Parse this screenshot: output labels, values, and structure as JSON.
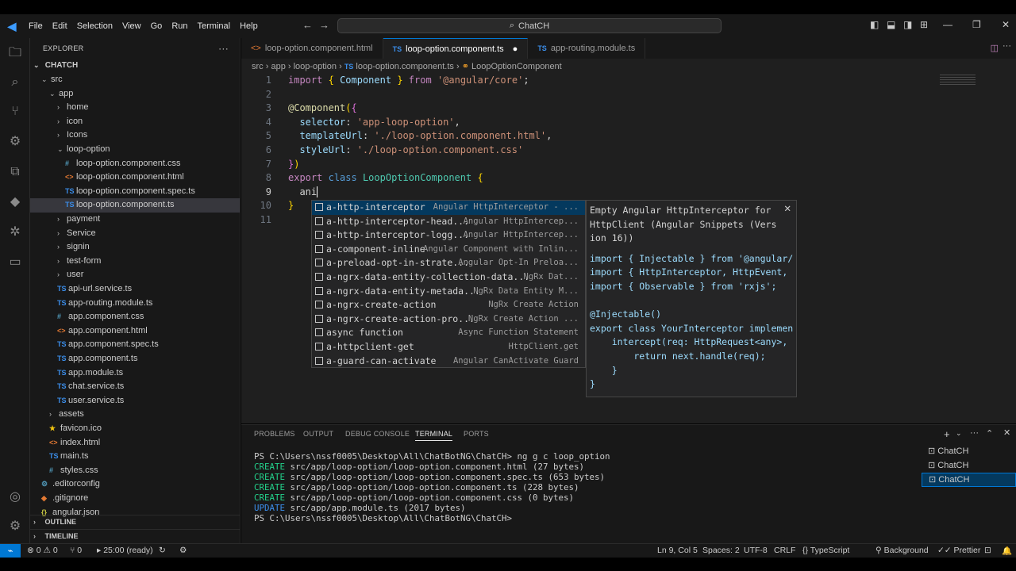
{
  "titlebar": {
    "menu": [
      "File",
      "Edit",
      "Selection",
      "View",
      "Go",
      "Run",
      "Terminal",
      "Help"
    ],
    "search_text": "ChatCH"
  },
  "sidebar": {
    "title": "EXPLORER",
    "root": "CHATCH",
    "items": [
      {
        "label": "src",
        "depth": 1,
        "kind": "folder-open"
      },
      {
        "label": "app",
        "depth": 2,
        "kind": "folder-open"
      },
      {
        "label": "home",
        "depth": 3,
        "kind": "folder"
      },
      {
        "label": "icon",
        "depth": 3,
        "kind": "folder"
      },
      {
        "label": "Icons",
        "depth": 3,
        "kind": "folder"
      },
      {
        "label": "loop-option",
        "depth": 3,
        "kind": "folder-open"
      },
      {
        "label": "loop-option.component.css",
        "depth": 4,
        "kind": "css"
      },
      {
        "label": "loop-option.component.html",
        "depth": 4,
        "kind": "html"
      },
      {
        "label": "loop-option.component.spec.ts",
        "depth": 4,
        "kind": "ts"
      },
      {
        "label": "loop-option.component.ts",
        "depth": 4,
        "kind": "ts",
        "selected": true
      },
      {
        "label": "payment",
        "depth": 3,
        "kind": "folder"
      },
      {
        "label": "Service",
        "depth": 3,
        "kind": "folder"
      },
      {
        "label": "signin",
        "depth": 3,
        "kind": "folder"
      },
      {
        "label": "test-form",
        "depth": 3,
        "kind": "folder"
      },
      {
        "label": "user",
        "depth": 3,
        "kind": "folder"
      },
      {
        "label": "api-url.service.ts",
        "depth": 3,
        "kind": "ts"
      },
      {
        "label": "app-routing.module.ts",
        "depth": 3,
        "kind": "ts"
      },
      {
        "label": "app.component.css",
        "depth": 3,
        "kind": "css"
      },
      {
        "label": "app.component.html",
        "depth": 3,
        "kind": "html"
      },
      {
        "label": "app.component.spec.ts",
        "depth": 3,
        "kind": "ts"
      },
      {
        "label": "app.component.ts",
        "depth": 3,
        "kind": "ts"
      },
      {
        "label": "app.module.ts",
        "depth": 3,
        "kind": "ts"
      },
      {
        "label": "chat.service.ts",
        "depth": 3,
        "kind": "ts"
      },
      {
        "label": "user.service.ts",
        "depth": 3,
        "kind": "ts"
      },
      {
        "label": "assets",
        "depth": 2,
        "kind": "folder"
      },
      {
        "label": "favicon.ico",
        "depth": 2,
        "kind": "star"
      },
      {
        "label": "index.html",
        "depth": 2,
        "kind": "html"
      },
      {
        "label": "main.ts",
        "depth": 2,
        "kind": "ts"
      },
      {
        "label": "styles.css",
        "depth": 2,
        "kind": "css"
      },
      {
        "label": ".editorconfig",
        "depth": 1,
        "kind": "gear"
      },
      {
        "label": ".gitignore",
        "depth": 1,
        "kind": "git"
      },
      {
        "label": "angular.json",
        "depth": 1,
        "kind": "json"
      }
    ],
    "outline": "OUTLINE",
    "timeline": "TIMELINE"
  },
  "tabs": [
    {
      "label": "loop-option.component.html",
      "icon": "<>",
      "active": false
    },
    {
      "label": "loop-option.component.ts",
      "icon": "TS",
      "active": true
    },
    {
      "label": "app-routing.module.ts",
      "icon": "TS",
      "active": false
    }
  ],
  "breadcrumb": [
    "src",
    "app",
    "loop-option",
    "loop-option.component.ts",
    "LoopOptionComponent"
  ],
  "editor": {
    "line_numbers": [
      "1",
      "2",
      "3",
      "4",
      "5",
      "6",
      "7",
      "8",
      "9",
      "10",
      "11"
    ],
    "typed": "ani"
  },
  "suggest": [
    {
      "label": "a-http-interceptor",
      "detail": "Angular HttpInterceptor - ..."
    },
    {
      "label": "a-http-interceptor-head...",
      "detail": "Angular HttpIntercep..."
    },
    {
      "label": "a-http-interceptor-logg...",
      "detail": "Angular HttpIntercep..."
    },
    {
      "label": "a-component-inline",
      "detail": "Angular Component with Inlin..."
    },
    {
      "label": "a-preload-opt-in-strate...",
      "detail": "Angular Opt-In Preloa..."
    },
    {
      "label": "a-ngrx-data-entity-collection-data...",
      "detail": "NgRx Dat..."
    },
    {
      "label": "a-ngrx-data-entity-metada...",
      "detail": "NgRx Data Entity M..."
    },
    {
      "label": "a-ngrx-create-action",
      "detail": "NgRx Create Action"
    },
    {
      "label": "a-ngrx-create-action-pro...",
      "detail": "NgRx Create Action ..."
    },
    {
      "label": "async function",
      "detail": "Async Function Statement"
    },
    {
      "label": "a-httpclient-get",
      "detail": "HttpClient.get"
    },
    {
      "label": "a-guard-can-activate",
      "detail": "Angular CanActivate Guard"
    }
  ],
  "details": {
    "description": "Empty Angular HttpInterceptor for\nHttpClient (Angular Snippets (Vers\nion 16))",
    "code": "import { Injectable } from '@angular/\nimport { HttpInterceptor, HttpEvent,\nimport { Observable } from 'rxjs';\n\n@Injectable()\nexport class YourInterceptor implemen\n    intercept(req: HttpRequest<any>,\n        return next.handle(req);\n    }\n}"
  },
  "panel": {
    "tabs": [
      "PROBLEMS",
      "OUTPUT",
      "DEBUG CONSOLE",
      "TERMINAL",
      "PORTS"
    ],
    "terminal": [
      {
        "prefix": "PS ",
        "text": "C:\\Users\\nssf0005\\Desktop\\All\\ChatBotNG\\ChatCH> ng g c loop_option",
        "kind": "prompt"
      },
      {
        "prefix": "CREATE",
        "text": " src/app/loop-option/loop-option.component.html (27 bytes)",
        "kind": "create"
      },
      {
        "prefix": "CREATE",
        "text": " src/app/loop-option/loop-option.component.spec.ts (653 bytes)",
        "kind": "create"
      },
      {
        "prefix": "CREATE",
        "text": " src/app/loop-option/loop-option.component.ts (228 bytes)",
        "kind": "create"
      },
      {
        "prefix": "CREATE",
        "text": " src/app/loop-option/loop-option.component.css (0 bytes)",
        "kind": "create"
      },
      {
        "prefix": "UPDATE",
        "text": " src/app/app.module.ts (2017 bytes)",
        "kind": "update"
      },
      {
        "prefix": "PS ",
        "text": "C:\\Users\\nssf0005\\Desktop\\All\\ChatBotNG\\ChatCH> ",
        "kind": "prompt"
      }
    ],
    "instances": [
      "ChatCH",
      "ChatCH",
      "ChatCH"
    ]
  },
  "statusbar": {
    "errors": "0",
    "warnings": "0",
    "ports": "0",
    "task": "25:00 (ready)",
    "position": "Ln 9, Col 5",
    "spaces": "Spaces: 2",
    "encoding": "UTF-8",
    "eol": "CRLF",
    "language": "TypeScript",
    "background": "Background",
    "prettier": "Prettier"
  }
}
